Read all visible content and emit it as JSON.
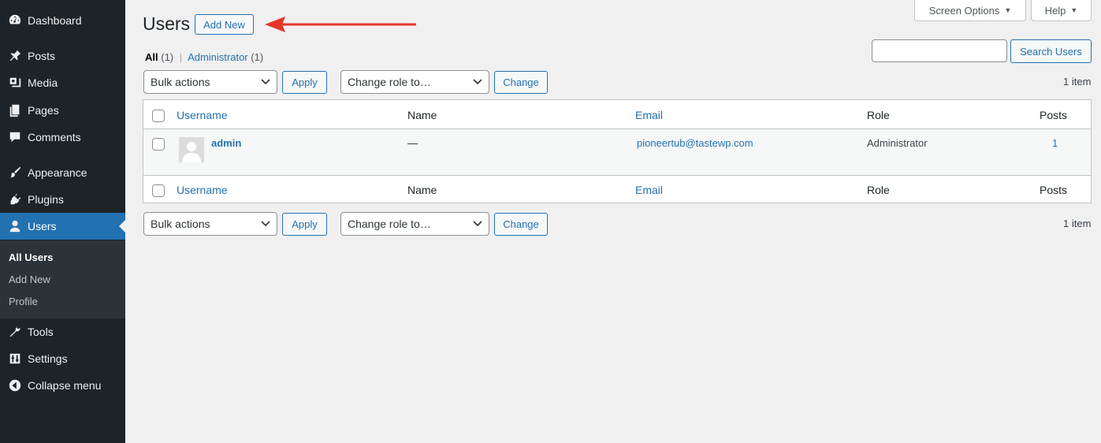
{
  "sidebar": {
    "items": [
      {
        "label": "Dashboard",
        "icon": "dashboard-icon"
      },
      {
        "label": "Posts",
        "icon": "pin-icon"
      },
      {
        "label": "Media",
        "icon": "media-icon"
      },
      {
        "label": "Pages",
        "icon": "pages-icon"
      },
      {
        "label": "Comments",
        "icon": "comment-icon"
      },
      {
        "label": "Appearance",
        "icon": "brush-icon"
      },
      {
        "label": "Plugins",
        "icon": "plug-icon"
      },
      {
        "label": "Users",
        "icon": "user-icon"
      },
      {
        "label": "Tools",
        "icon": "wrench-icon"
      },
      {
        "label": "Settings",
        "icon": "settings-icon"
      },
      {
        "label": "Collapse menu",
        "icon": "collapse-icon"
      }
    ],
    "submenu": [
      "All Users",
      "Add New",
      "Profile"
    ]
  },
  "header": {
    "title": "Users",
    "add_new": "Add New",
    "screen_options": "Screen Options",
    "help": "Help"
  },
  "filters": {
    "all_label": "All",
    "all_count": "(1)",
    "separator": "|",
    "admin_label": "Administrator",
    "admin_count": "(1)"
  },
  "search": {
    "button": "Search Users",
    "value": ""
  },
  "actions": {
    "bulk": "Bulk actions",
    "apply": "Apply",
    "change_role": "Change role to…",
    "change": "Change",
    "item_count": "1 item"
  },
  "table": {
    "columns": [
      "Username",
      "Name",
      "Email",
      "Role",
      "Posts"
    ],
    "rows": [
      {
        "username": "admin",
        "name": "—",
        "email": "pioneertub@tastewp.com",
        "role": "Administrator",
        "posts": "1"
      }
    ]
  }
}
